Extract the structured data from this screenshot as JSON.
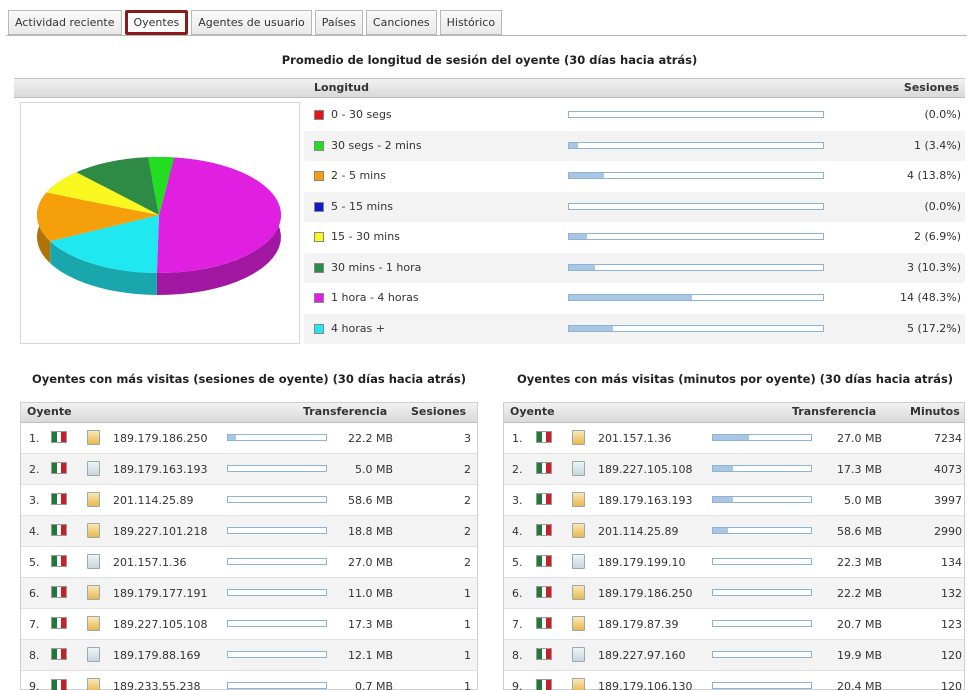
{
  "tabs": [
    {
      "label": "Actividad reciente",
      "active": false
    },
    {
      "label": "Oyentes",
      "active": true
    },
    {
      "label": "Agentes de usuario",
      "active": false
    },
    {
      "label": "Países",
      "active": false
    },
    {
      "label": "Canciones",
      "active": false
    },
    {
      "label": "Histórico",
      "active": false
    }
  ],
  "session_length": {
    "title": "Promedio de longitud de sesión del oyente (30 días hacia atrás)",
    "col_length": "Longitud",
    "col_sessions": "Sesiones",
    "rows": [
      {
        "label": "0 - 30 segs",
        "color": "#e8141c",
        "value": "(0.0%)",
        "fraction": 0.0
      },
      {
        "label": "30 segs - 2 mins",
        "color": "#22dd22",
        "value": "1 (3.4%)",
        "fraction": 0.034
      },
      {
        "label": "2 - 5 mins",
        "color": "#f5a00a",
        "value": "4 (13.8%)",
        "fraction": 0.138
      },
      {
        "label": "5 - 15 mins",
        "color": "#1515d0",
        "value": "(0.0%)",
        "fraction": 0.0
      },
      {
        "label": "15 - 30 mins",
        "color": "#f8f820",
        "value": "2 (6.9%)",
        "fraction": 0.069
      },
      {
        "label": "30 mins - 1 hora",
        "color": "#2e8b45",
        "value": "3 (10.3%)",
        "fraction": 0.103
      },
      {
        "label": "1 hora - 4 horas",
        "color": "#e020e0",
        "value": "14 (48.3%)",
        "fraction": 0.483
      },
      {
        "label": "4 horas +",
        "color": "#20e8f0",
        "value": "5 (17.2%)",
        "fraction": 0.172
      }
    ]
  },
  "top_sessions": {
    "title": "Oyentes con más visitas (sesiones de oyente) (30 días hacia atrás)",
    "col_listener": "Oyente",
    "col_transfer": "Transferencia",
    "col_count": "Sesiones",
    "rows": [
      {
        "num": "1.",
        "ip": "189.179.186.250",
        "transfer": "22.2 MB",
        "count": "3",
        "fraction": 0.08
      },
      {
        "num": "2.",
        "ip": "189.179.163.193",
        "transfer": "5.0 MB",
        "count": "2",
        "fraction": 0.0
      },
      {
        "num": "3.",
        "ip": "201.114.25.89",
        "transfer": "58.6 MB",
        "count": "2",
        "fraction": 0.0
      },
      {
        "num": "4.",
        "ip": "189.227.101.218",
        "transfer": "18.8 MB",
        "count": "2",
        "fraction": 0.0
      },
      {
        "num": "5.",
        "ip": "201.157.1.36",
        "transfer": "27.0 MB",
        "count": "2",
        "fraction": 0.0
      },
      {
        "num": "6.",
        "ip": "189.179.177.191",
        "transfer": "11.0 MB",
        "count": "1",
        "fraction": 0.0
      },
      {
        "num": "7.",
        "ip": "189.227.105.108",
        "transfer": "17.3 MB",
        "count": "1",
        "fraction": 0.0
      },
      {
        "num": "8.",
        "ip": "189.179.88.169",
        "transfer": "12.1 MB",
        "count": "1",
        "fraction": 0.0
      },
      {
        "num": "9.",
        "ip": "189.233.55.238",
        "transfer": "0.7 MB",
        "count": "1",
        "fraction": 0.0
      }
    ]
  },
  "top_minutes": {
    "title": "Oyentes con más visitas (minutos por oyente) (30 días hacia atrás)",
    "col_listener": "Oyente",
    "col_transfer": "Transferencia",
    "col_count": "Minutos",
    "rows": [
      {
        "num": "1.",
        "ip": "201.157.1.36",
        "transfer": "27.0 MB",
        "count": "7234",
        "fraction": 0.37
      },
      {
        "num": "2.",
        "ip": "189.227.105.108",
        "transfer": "17.3 MB",
        "count": "4073",
        "fraction": 0.2
      },
      {
        "num": "3.",
        "ip": "189.179.163.193",
        "transfer": "5.0 MB",
        "count": "3997",
        "fraction": 0.2
      },
      {
        "num": "4.",
        "ip": "201.114.25.89",
        "transfer": "58.6 MB",
        "count": "2990",
        "fraction": 0.15
      },
      {
        "num": "5.",
        "ip": "189.179.199.10",
        "transfer": "22.3 MB",
        "count": "134",
        "fraction": 0.0
      },
      {
        "num": "6.",
        "ip": "189.179.186.250",
        "transfer": "22.2 MB",
        "count": "132",
        "fraction": 0.0
      },
      {
        "num": "7.",
        "ip": "189.179.87.39",
        "transfer": "20.7 MB",
        "count": "123",
        "fraction": 0.0
      },
      {
        "num": "8.",
        "ip": "189.227.97.160",
        "transfer": "19.9 MB",
        "count": "120",
        "fraction": 0.0
      },
      {
        "num": "9.",
        "ip": "189.179.106.130",
        "transfer": "20.4 MB",
        "count": "120",
        "fraction": 0.0
      }
    ]
  },
  "chart_data": {
    "type": "pie",
    "title": "",
    "categories": [
      "0 - 30 segs",
      "30 segs - 2 mins",
      "2 - 5 mins",
      "5 - 15 mins",
      "15 - 30 mins",
      "30 mins - 1 hora",
      "1 hora - 4 horas",
      "4 horas +"
    ],
    "values": [
      0,
      1,
      4,
      0,
      2,
      3,
      14,
      5
    ],
    "colors": [
      "#e8141c",
      "#22dd22",
      "#f5a00a",
      "#1515d0",
      "#f8f820",
      "#2e8b45",
      "#e020e0",
      "#20e8f0"
    ]
  }
}
